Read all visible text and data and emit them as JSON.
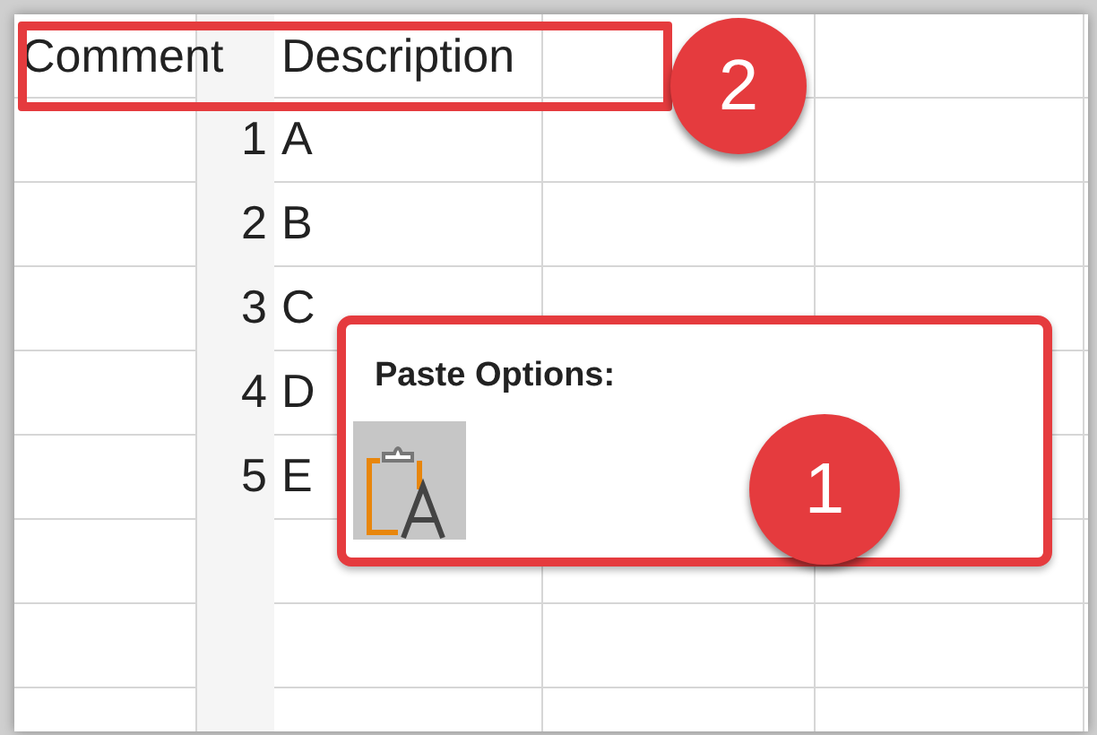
{
  "sheet": {
    "header": [
      "Comment",
      "Description"
    ],
    "rows": [
      {
        "number": "1",
        "letter": "A"
      },
      {
        "number": "2",
        "letter": "B"
      },
      {
        "number": "3",
        "letter": "C"
      },
      {
        "number": "4",
        "letter": "D"
      },
      {
        "number": "5",
        "letter": "E"
      }
    ]
  },
  "paste_options": {
    "title": "Paste Options:",
    "buttons": [
      {
        "kind": "keep-text",
        "selected": true
      }
    ]
  },
  "callouts": [
    {
      "number": "2"
    },
    {
      "number": "1"
    }
  ]
}
